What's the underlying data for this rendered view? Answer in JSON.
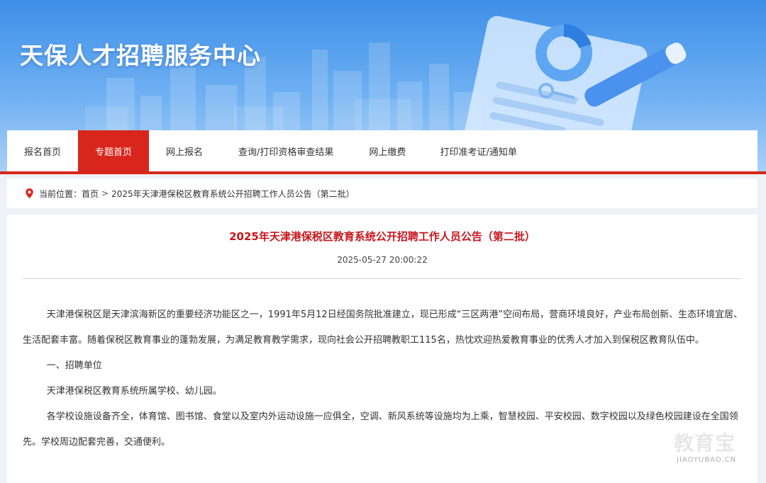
{
  "header": {
    "site_title": "天保人才招聘服务中心"
  },
  "nav": {
    "items": [
      {
        "label": "报名首页",
        "active": false
      },
      {
        "label": "专题首页",
        "active": true
      },
      {
        "label": "网上报名",
        "active": false
      },
      {
        "label": "查询/打印资格审查结果",
        "active": false
      },
      {
        "label": "网上缴费",
        "active": false
      },
      {
        "label": "打印准考证/通知单",
        "active": false
      }
    ]
  },
  "breadcrumb": {
    "prefix": "当前位置：",
    "home": "首页",
    "separator": ">",
    "current": "2025年天津港保税区教育系统公开招聘工作人员公告（第二批）"
  },
  "article": {
    "title": "2025年天津港保税区教育系统公开招聘工作人员公告（第二批）",
    "date": "2025-05-27 20:00:22",
    "paragraphs": [
      "天津港保税区是天津滨海新区的重要经济功能区之一，1991年5月12日经国务院批准建立，现已形成“三区两港”空间布局，营商环境良好，产业布局创新、生态环境宜居、生活配套丰富。随着保税区教育事业的蓬勃发展，为满足教育教学需求，现向社会公开招聘教职工115名，热忱欢迎热爱教育事业的优秀人才加入到保税区教育队伍中。",
      "一、招聘单位",
      "天津港保税区教育系统所属学校、幼儿园。",
      "各学校设施设备齐全，体育馆、图书馆、食堂以及室内外运动设施一应俱全，空调、新风系统等设施均为上乘，智慧校园、平安校园、数字校园以及绿色校园建设在全国领先。学校周边配套完善，交通便利。"
    ]
  },
  "watermark": {
    "main": "教育宝",
    "sub": "JIAOYUBAO.CN"
  },
  "colors": {
    "accent_red": "#d9261c",
    "title_red": "#c8161d",
    "banner_blue": "#3d8fe8"
  }
}
